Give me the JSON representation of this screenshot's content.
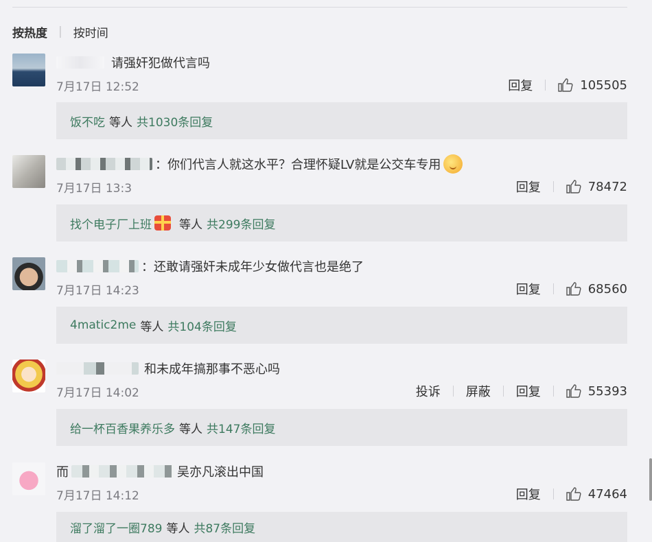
{
  "sort": {
    "hot": "按热度",
    "separator": "|",
    "time": "按时间"
  },
  "comments": [
    {
      "name_visible": "",
      "text": "请强奸犯做代言吗",
      "time": "7月17日 12:52",
      "actions": [
        "回复"
      ],
      "likes": "105505",
      "reply_preview": {
        "names": "饭不吃",
        "etc": "等人",
        "total": "共1030条回复"
      }
    },
    {
      "name_visible": "",
      "text": "：你们代言人就这水平？合理怀疑LV就是公交车专用",
      "time": "7月17日 13:3",
      "actions": [
        "回复"
      ],
      "likes": "78472",
      "reply_preview": {
        "names": "找个电子厂上班",
        "etc": "等人",
        "total": "共299条回复"
      }
    },
    {
      "name_visible": "",
      "text": "：还敢请强奸未成年少女做代言也是绝了",
      "time": "7月17日 14:23",
      "actions": [
        "回复"
      ],
      "likes": "68560",
      "reply_preview": {
        "names": "4matic2me",
        "etc": "等人",
        "total": "共104条回复"
      }
    },
    {
      "name_visible": "",
      "text": "和未成年搞那事不恶心吗",
      "time": "7月17日 14:02",
      "actions": [
        "投诉",
        "屏蔽",
        "回复"
      ],
      "likes": "55393",
      "reply_preview": {
        "names": "给一杯百香果养乐多",
        "etc": "等人",
        "total": "共147条回复"
      }
    },
    {
      "name_visible": "而",
      "text": "吴亦凡滚出中国",
      "time": "7月17日 14:12",
      "actions": [
        "回复"
      ],
      "likes": "47464",
      "reply_preview": {
        "names": "溜了溜了一圈789",
        "etc": "等人",
        "total": "共87条回复"
      }
    }
  ]
}
